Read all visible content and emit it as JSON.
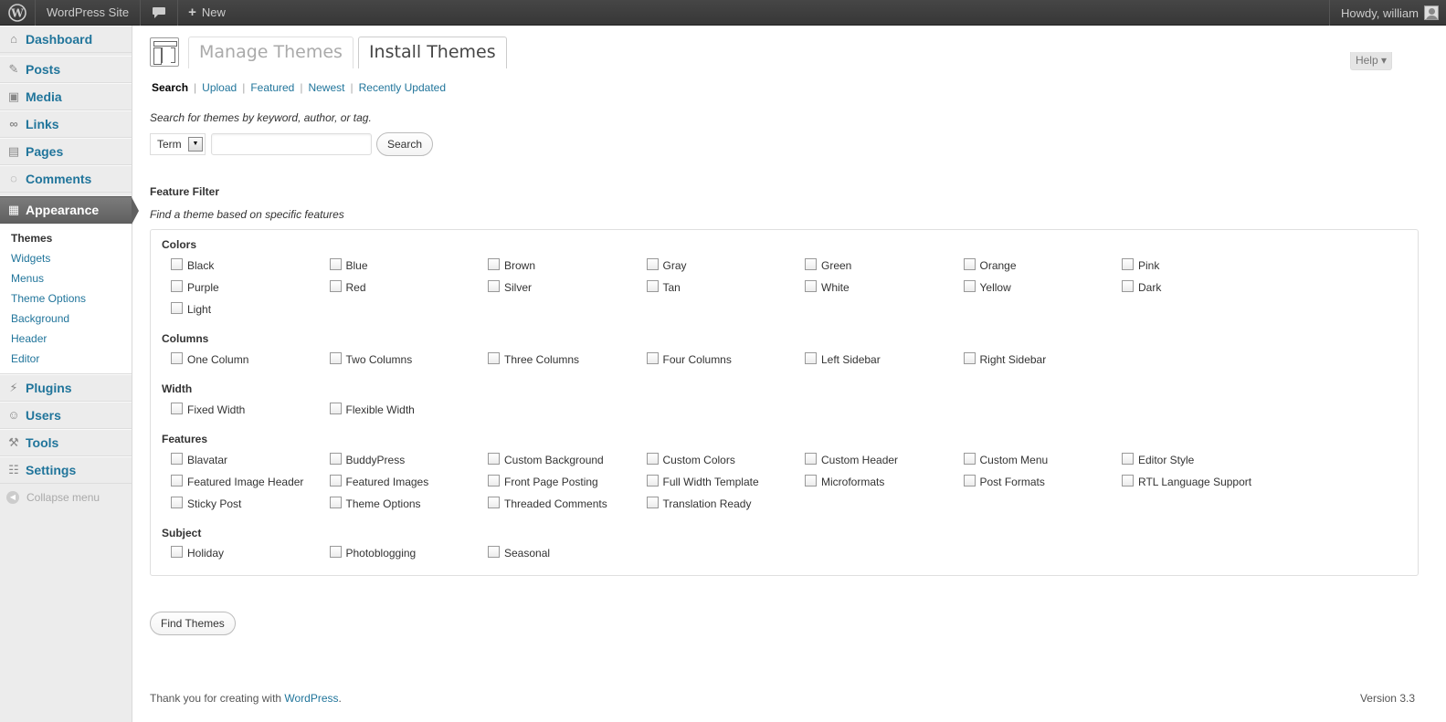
{
  "adminbar": {
    "site_name": "WordPress Site",
    "new_label": "New",
    "howdy": "Howdy, william"
  },
  "sidebar": {
    "items_top": [
      {
        "label": "Dashboard",
        "icon": "dashboard-icon"
      },
      {
        "label": "Posts",
        "icon": "pin-icon"
      },
      {
        "label": "Media",
        "icon": "media-icon"
      },
      {
        "label": "Links",
        "icon": "link-icon"
      },
      {
        "label": "Pages",
        "icon": "pages-icon"
      },
      {
        "label": "Comments",
        "icon": "comment-icon"
      }
    ],
    "appearance": "Appearance",
    "submenu": [
      "Themes",
      "Widgets",
      "Menus",
      "Theme Options",
      "Background",
      "Header",
      "Editor"
    ],
    "items_bottom": [
      {
        "label": "Plugins",
        "icon": "plugin-icon"
      },
      {
        "label": "Users",
        "icon": "users-icon"
      },
      {
        "label": "Tools",
        "icon": "tools-icon"
      },
      {
        "label": "Settings",
        "icon": "settings-icon"
      }
    ],
    "collapse": "Collapse menu"
  },
  "main": {
    "help": "Help ▾",
    "tabs": [
      "Manage Themes",
      "Install Themes"
    ],
    "subnav": [
      "Search",
      "Upload",
      "Featured",
      "Newest",
      "Recently Updated"
    ],
    "search_desc": "Search for themes by keyword, author, or tag.",
    "term_select": "Term",
    "search_button": "Search",
    "feature_title": "Feature Filter",
    "feature_desc": "Find a theme based on specific features",
    "groups": {
      "colors": "Colors",
      "columns": "Columns",
      "width": "Width",
      "features": "Features",
      "subject": "Subject"
    },
    "colors": [
      "Black",
      "Blue",
      "Brown",
      "Gray",
      "Green",
      "Orange",
      "Pink",
      "Purple",
      "Red",
      "Silver",
      "Tan",
      "White",
      "Yellow",
      "Dark",
      "Light"
    ],
    "columns": [
      "One Column",
      "Two Columns",
      "Three Columns",
      "Four Columns",
      "Left Sidebar",
      "Right Sidebar"
    ],
    "width": [
      "Fixed Width",
      "Flexible Width"
    ],
    "features": [
      "Blavatar",
      "BuddyPress",
      "Custom Background",
      "Custom Colors",
      "Custom Header",
      "Custom Menu",
      "Editor Style",
      "Featured Image Header",
      "Featured Images",
      "Front Page Posting",
      "Full Width Template",
      "Microformats",
      "Post Formats",
      "RTL Language Support",
      "Sticky Post",
      "Theme Options",
      "Threaded Comments",
      "Translation Ready"
    ],
    "subject": [
      "Holiday",
      "Photoblogging",
      "Seasonal"
    ],
    "find_button": "Find Themes"
  },
  "footer": {
    "thanks": "Thank you for creating with ",
    "wp_link": "WordPress",
    "period": ".",
    "version": "Version 3.3"
  },
  "colors": {
    "link": "#21759b",
    "adminbar": "#464646",
    "current_menu": "#6d6d6d"
  }
}
